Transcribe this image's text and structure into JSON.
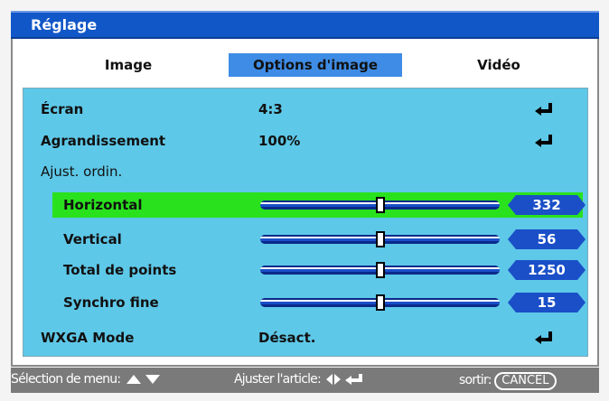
{
  "window": {
    "title": "Réglage"
  },
  "tabs": [
    {
      "label": "Image",
      "active": false
    },
    {
      "label": "Options d'image",
      "active": true
    },
    {
      "label": "Vidéo",
      "active": false
    }
  ],
  "rows": {
    "ecran": {
      "label": "Écran",
      "value": "4:3"
    },
    "agrandissement": {
      "label": "Agrandissement",
      "value": "100%"
    },
    "ajust": {
      "label": "Ajust. ordin."
    },
    "horizontal": {
      "label": "Horizontal",
      "value": "332",
      "selected": true
    },
    "vertical": {
      "label": "Vertical",
      "value": "56"
    },
    "total": {
      "label": "Total de points",
      "value": "1250"
    },
    "synchro": {
      "label": "Synchro fine",
      "value": "15"
    },
    "wxga": {
      "label": "WXGA Mode",
      "value": "Désact."
    }
  },
  "footer": {
    "select_label": "Sélection de menu:",
    "adjust_label": "Ajuster l'article:",
    "exit_label": "sortir:",
    "cancel_key": "CANCEL"
  },
  "colors": {
    "title_bar": "#1257c8",
    "tab_active": "#3e8ce6",
    "panel": "#5ec8e8",
    "selected_row": "#29e21d",
    "badge": "#1a4fc8"
  },
  "icons": [
    "enter-icon",
    "up-down-arrows-icon",
    "left-right-arrows-icon"
  ]
}
